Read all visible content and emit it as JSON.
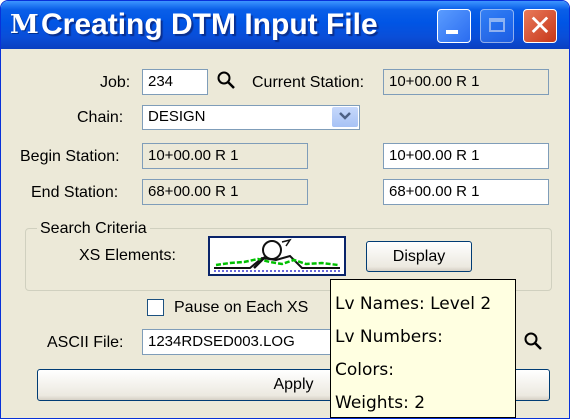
{
  "window": {
    "title": "Creating DTM Input File",
    "app_icon": "microstation-icon"
  },
  "form": {
    "job_label": "Job:",
    "job_value": "234",
    "current_station_label": "Current Station:",
    "current_station_value": "10+00.00 R 1",
    "chain_label": "Chain:",
    "chain_value": "DESIGN",
    "begin_station_label": "Begin Station:",
    "begin_station_current": "10+00.00 R 1",
    "begin_station_value": "10+00.00 R 1",
    "end_station_label": "End Station:",
    "end_station_current": "68+00.00 R 1",
    "end_station_value": "68+00.00 R 1"
  },
  "search": {
    "group_label": "Search Criteria",
    "xs_elements_label": "XS Elements:",
    "display_label": "Display"
  },
  "pause_label": "Pause on Each XS",
  "pause_checked": false,
  "ascii_label": "ASCII File:",
  "ascii_value": "1234RDSED003.LOG",
  "apply_label": "Apply",
  "tooltip": {
    "lines": [
      "Lv Names: Level 2",
      "Lv Numbers:",
      "Colors:",
      "Weights: 2"
    ]
  },
  "colors": {
    "titlebar": "#0055e5",
    "close_button": "#c7371a",
    "tooltip_bg": "#ffffe1",
    "dialog_bg": "#ece9d8"
  }
}
